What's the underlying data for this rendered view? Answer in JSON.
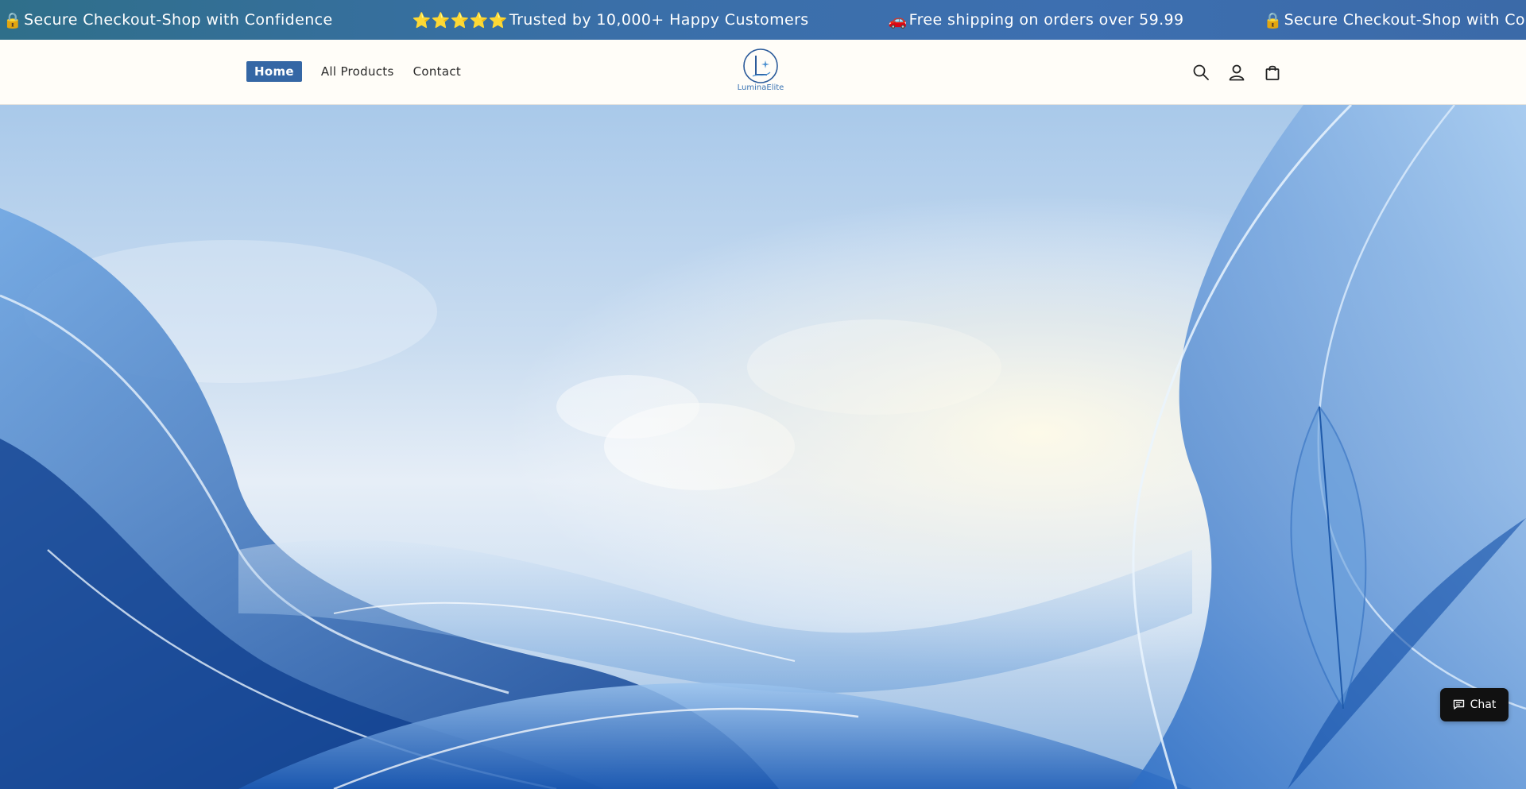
{
  "announcement": {
    "items": [
      {
        "glyph": "🔒",
        "text": "Secure Checkout-Shop with Confidence"
      },
      {
        "glyph": "⭐⭐⭐⭐⭐",
        "text": "Trusted by 10,000+ Happy Customers"
      },
      {
        "glyph": "🚗",
        "text": "Free shipping on orders over 59.99"
      },
      {
        "glyph": "🔒",
        "text": "Secure Checkout-Shop with Confidence"
      }
    ]
  },
  "nav": {
    "home": "Home",
    "all_products": "All Products",
    "contact": "Contact"
  },
  "logo": {
    "text": "LuminaElite"
  },
  "header_icons": [
    "search-icon",
    "account-icon",
    "cart-icon"
  ],
  "chat": {
    "label": "Chat"
  },
  "colors": {
    "announcement_bg": "#3a6fa8",
    "active_nav_bg": "#3567a5",
    "header_bg": "#fffdf8",
    "chat_bg": "#111111"
  }
}
